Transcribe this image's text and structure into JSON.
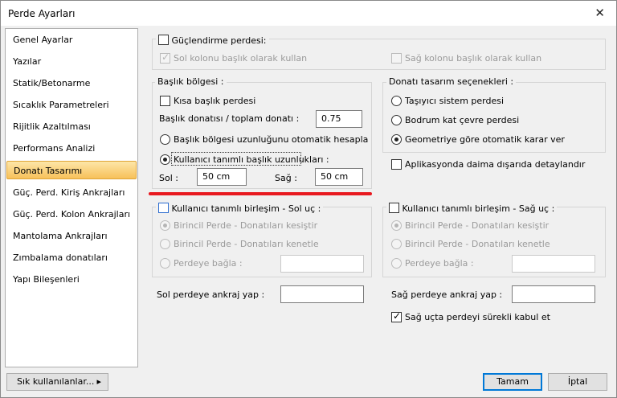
{
  "window": {
    "title": "Perde Ayarları"
  },
  "sidebar": {
    "items": [
      {
        "label": "Genel Ayarlar"
      },
      {
        "label": "Yazılar"
      },
      {
        "label": "Statik/Betonarme"
      },
      {
        "label": "Sıcaklık Parametreleri"
      },
      {
        "label": "Rijitlik Azaltılması"
      },
      {
        "label": "Performans Analizi"
      },
      {
        "label": "Donatı Tasarımı",
        "selected": true
      },
      {
        "label": "Güç. Perd. Kiriş Ankrajları"
      },
      {
        "label": "Güç. Perd. Kolon Ankrajları"
      },
      {
        "label": "Mantolama Ankrajları"
      },
      {
        "label": "Zımbalama donatıları"
      },
      {
        "label": "Yapı Bileşenleri"
      }
    ]
  },
  "strengthening": {
    "label": "Güçlendirme perdesi:",
    "checked": false,
    "left_header": "Sol kolonu başlık olarak kullan",
    "left_header_checked": true,
    "right_header": "Sağ kolonu başlık olarak kullan",
    "right_header_checked": false
  },
  "header_region": {
    "group_label": "Başlık bölgesi :",
    "short_header": "Kısa başlık perdesi",
    "ratio_label": "Başlık donatısı / toplam donatı :",
    "ratio_value": "0.75",
    "auto_option": "Başlık bölgesi uzunluğunu otomatik hesapla",
    "user_option": "Kullanıcı tanımlı başlık uzunlukları :",
    "left_label": "Sol :",
    "left_value": "50 cm",
    "right_label": "Sağ :",
    "right_value": "50 cm"
  },
  "design_options": {
    "group_label": "Donatı tasarım seçenekleri :",
    "options": [
      {
        "label": "Taşıyıcı sistem perdesi",
        "checked": false
      },
      {
        "label": "Bodrum kat çevre perdesi",
        "checked": false
      },
      {
        "label": "Geometriye göre otomatik karar ver",
        "checked": true
      }
    ],
    "detail_label": "Aplikasyonda daima dışarıda detaylandır"
  },
  "left_joint": {
    "label": "Kullanıcı tanımlı birleşim - Sol uç :",
    "options": [
      "Birincil Perde - Donatıları kesiştir",
      "Birincil Perde - Donatıları kenetle",
      "Perdeye bağla :"
    ],
    "wall_value": ""
  },
  "right_joint": {
    "label": "Kullanıcı tanımlı birleşim - Sağ uç :",
    "options": [
      "Birincil Perde - Donatıları kesiştir",
      "Birincil Perde - Donatıları kenetle",
      "Perdeye bağla :"
    ],
    "wall_value": ""
  },
  "anchorage": {
    "left_label": "Sol perdeye ankraj yap :",
    "left_value": "",
    "right_label": "Sağ perdeye ankraj yap :",
    "right_value": "",
    "continuous_label": "Sağ uçta perdeyi sürekli kabul et",
    "continuous_checked": true
  },
  "footer": {
    "favorites": "Sık kullanılanlar...",
    "favorites_arrow": "▸",
    "ok": "Tamam",
    "cancel": "İptal"
  },
  "icons": {
    "close": "close-icon"
  },
  "colors": {
    "highlight": "#e8191f",
    "selection": "#f7c15a",
    "default_border": "#0078d7"
  }
}
